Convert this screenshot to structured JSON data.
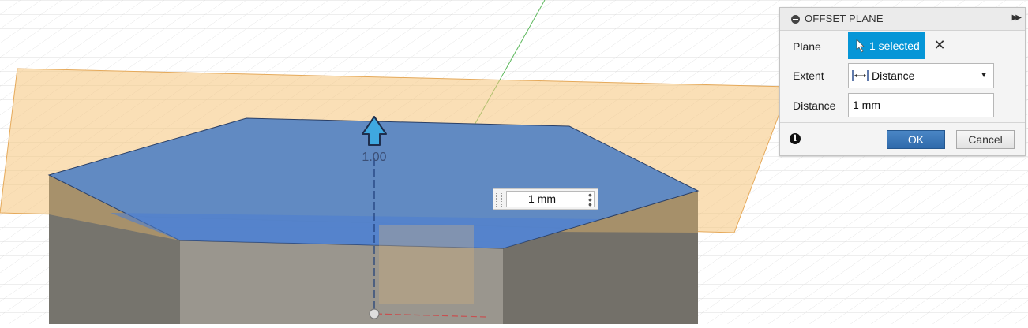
{
  "viewport": {
    "manipulator_value": "1.00",
    "inline_distance_value": "1 mm"
  },
  "dialog": {
    "title": "OFFSET PLANE",
    "plane_label": "Plane",
    "plane_selection": "1 selected",
    "extent_label": "Extent",
    "extent_value": "Distance",
    "distance_label": "Distance",
    "distance_value": "1 mm",
    "ok_label": "OK",
    "cancel_label": "Cancel"
  },
  "colors": {
    "selection_blue": "#0696d7",
    "preview_plane": "#f5c57a",
    "selected_face": "#5b86c3",
    "body_side": "#7a7a7a"
  }
}
